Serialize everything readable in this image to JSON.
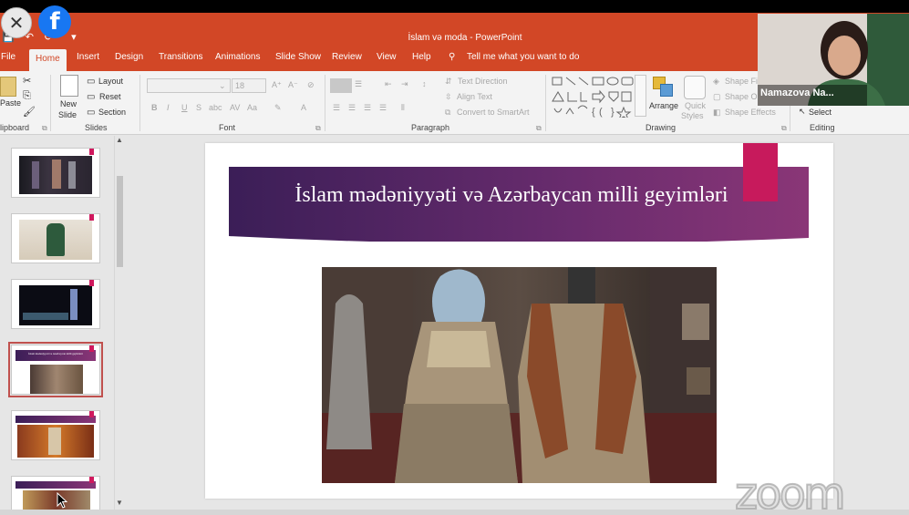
{
  "window": {
    "title": "İslam və moda - PowerPoint"
  },
  "overlay": {
    "close_glyph": "✕",
    "fb_glyph": "f"
  },
  "qat": {
    "save": "💾",
    "undo": "↶",
    "redo": "⟳",
    "more": "▾"
  },
  "tabs": [
    "File",
    "Home",
    "Insert",
    "Design",
    "Transitions",
    "Animations",
    "Slide Show",
    "Review",
    "View",
    "Help"
  ],
  "tell_me": "Tell me what you want to do",
  "ribbon": {
    "clipboard": {
      "paste": "Paste",
      "label": "lipboard"
    },
    "slides": {
      "new_slide": "New",
      "new_slide2": "Slide",
      "layout": "Layout",
      "reset": "Reset",
      "section": "Section",
      "label": "Slides"
    },
    "font": {
      "size": "18",
      "label": "Font"
    },
    "paragraph": {
      "text_direction": "Text Direction",
      "align_text": "Align Text",
      "smartart": "Convert to SmartArt",
      "label": "Paragraph"
    },
    "drawing": {
      "arrange": "Arrange",
      "quick_styles": "Quick",
      "quick_styles2": "Styles",
      "shape_fill": "Shape Fi",
      "shape_outline": "Shape O",
      "shape_effects": "Shape Effects",
      "label": "Drawing"
    },
    "editing": {
      "select": "Select",
      "label": "Editing"
    }
  },
  "slide": {
    "title": "İslam mədəniyyəti və Azərbaycan milli geyimləri"
  },
  "thumb_selected_caption": "İslam mədəniyyəti və Azərbaycan milli geyimləri",
  "webcam": {
    "name": "Namazova Na..."
  },
  "watermark": "zoom",
  "colors": {
    "accent": "#d24726",
    "banner_start": "#3b1e57",
    "banner_end": "#8a3677",
    "pink": "#c71a5c"
  }
}
